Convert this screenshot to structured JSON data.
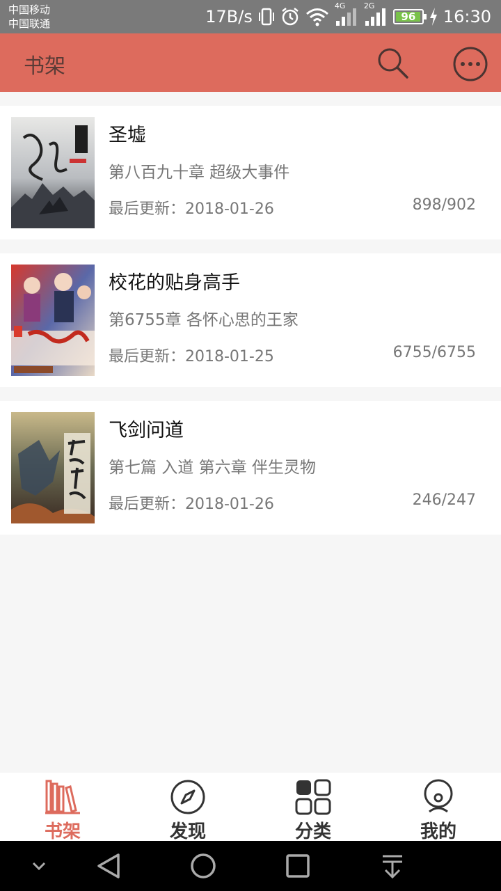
{
  "status_bar": {
    "carrier1": "中国移动",
    "carrier2": "中国联通",
    "speed": "17B/s",
    "net1": "4G",
    "net2": "2G",
    "battery": "96",
    "time": "16:30"
  },
  "app_bar": {
    "title": "书架",
    "search_icon": "search-icon",
    "more_icon": "more-icon"
  },
  "books": [
    {
      "title": "圣墟",
      "chapter": "第八百九十章 超级大事件",
      "updated": "最后更新：2018-01-26",
      "progress": "898/902"
    },
    {
      "title": "校花的贴身高手",
      "chapter": "第6755章 各怀心思的王家",
      "updated": "最后更新：2018-01-25",
      "progress": "6755/6755"
    },
    {
      "title": "飞剑问道",
      "chapter": "第七篇 入道 第六章 伴生灵物",
      "updated": "最后更新：2018-01-26",
      "progress": "246/247"
    }
  ],
  "bottom_nav": [
    {
      "label": "书架",
      "icon": "bookshelf-icon",
      "active": true
    },
    {
      "label": "发现",
      "icon": "compass-icon",
      "active": false
    },
    {
      "label": "分类",
      "icon": "grid-icon",
      "active": false
    },
    {
      "label": "我的",
      "icon": "profile-icon",
      "active": false
    }
  ],
  "colors": {
    "accent": "#dd6b5d",
    "status_bar": "#7a7a7a",
    "background": "#f6f6f6"
  }
}
